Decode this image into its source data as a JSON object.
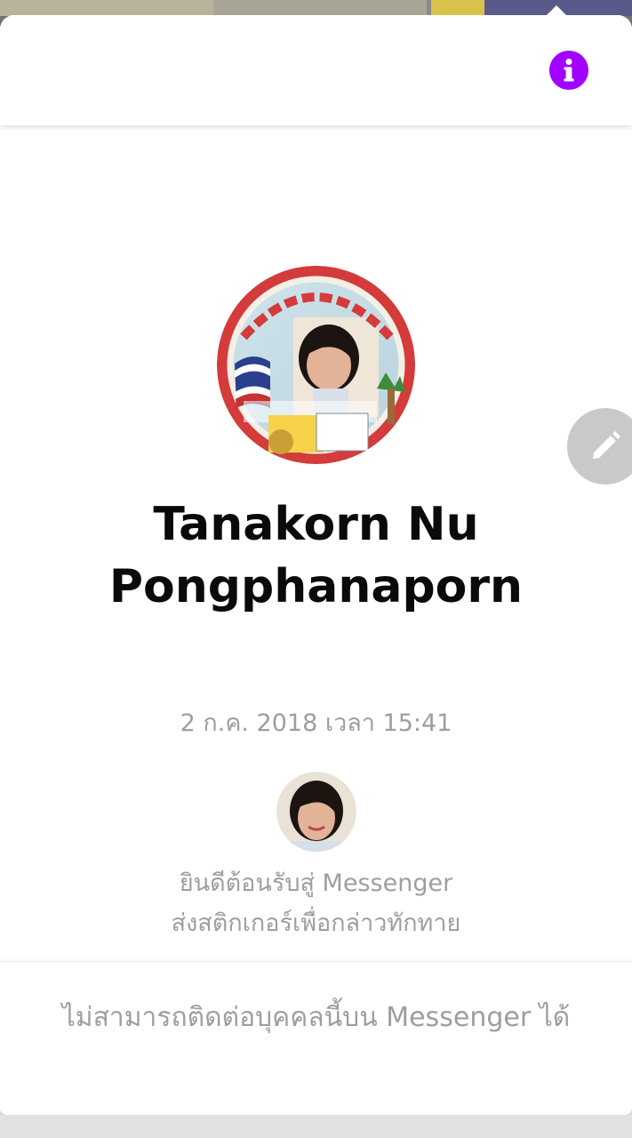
{
  "profile": {
    "name": "Tanakorn Nu Pongphanaporn"
  },
  "conversation": {
    "timestamp": "2 ก.ค. 2018 เวลา 15:41",
    "welcome_line1": "ยินดีต้อนรับสู่ Messenger",
    "welcome_line2": "ส่งสติกเกอร์เพื่อกล่าวทักทาย"
  },
  "footer": {
    "notice": "ไม่สามารถติดต่อบุคคลนี้บน Messenger ได้"
  },
  "colors": {
    "accent": "#a100ff",
    "muted_text": "#9e9e9e",
    "edit_button": "#c9c9c9"
  },
  "icons": {
    "info": "info-icon",
    "edit": "pencil-icon"
  }
}
